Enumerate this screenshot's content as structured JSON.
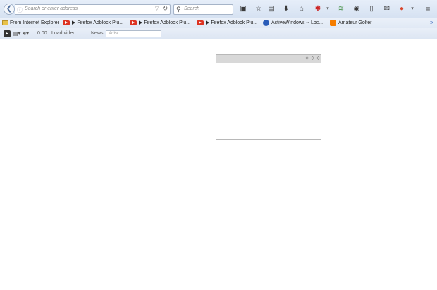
{
  "nav": {
    "url_placeholder": "Search or enter address",
    "search_placeholder": "Search"
  },
  "bookmarks": {
    "items": [
      {
        "label": "From Internet Explorer",
        "icon": "folder-icon"
      },
      {
        "label": "▶ Firefox Adblock Plu...",
        "icon": "youtube-icon"
      },
      {
        "label": "▶ Firefox Adblock Plu...",
        "icon": "youtube-icon"
      },
      {
        "label": "▶ Firefox Adblock Plu...",
        "icon": "youtube-icon"
      },
      {
        "label": "ActiveWindows -- Loc...",
        "icon": "activewindows-icon"
      },
      {
        "label": "Amateur Golfer",
        "icon": "blogger-icon"
      }
    ],
    "overflow": "»"
  },
  "media": {
    "time": "0:00",
    "load_video": "Load video ...",
    "news": "News",
    "artist_placeholder": "Artist"
  },
  "colors": {
    "toolbar": "#dfe8f5",
    "youtube": "#dd3322",
    "panel_header": "#d8d8d8"
  }
}
